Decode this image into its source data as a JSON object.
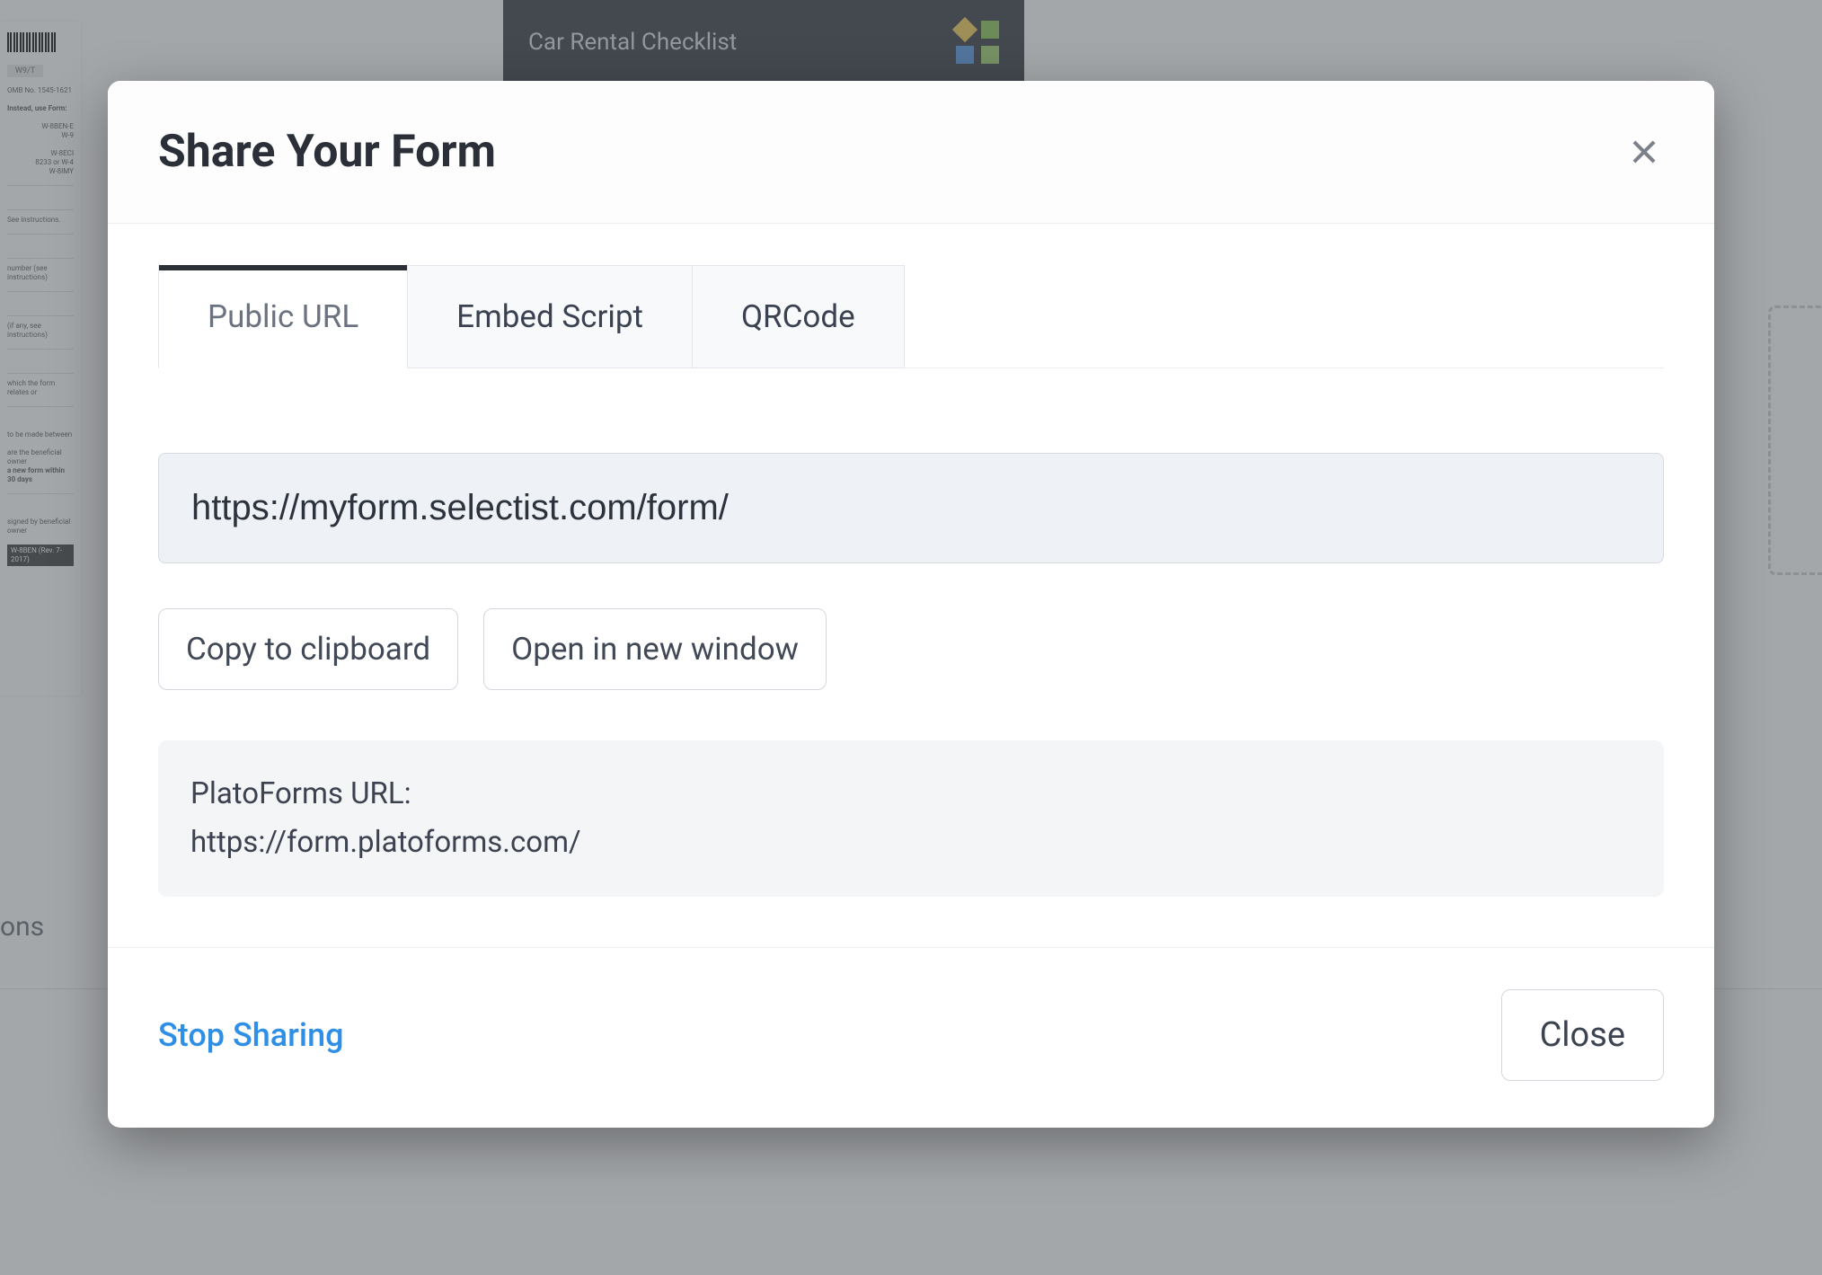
{
  "background": {
    "tab_title": "Car Rental Checklist",
    "doc_badge": "W9/T",
    "bottom_left_text": "ons"
  },
  "modal": {
    "title": "Share Your Form",
    "tabs": [
      {
        "label": "Public URL"
      },
      {
        "label": "Embed Script"
      },
      {
        "label": "QRCode"
      }
    ],
    "url": "https://myform.selectist.com/form/",
    "buttons": {
      "copy": "Copy to clipboard",
      "open": "Open in new window"
    },
    "info": {
      "label": "PlatoForms URL:",
      "value": "https://form.platoforms.com/"
    },
    "footer": {
      "stop_sharing": "Stop Sharing",
      "close": "Close"
    }
  }
}
